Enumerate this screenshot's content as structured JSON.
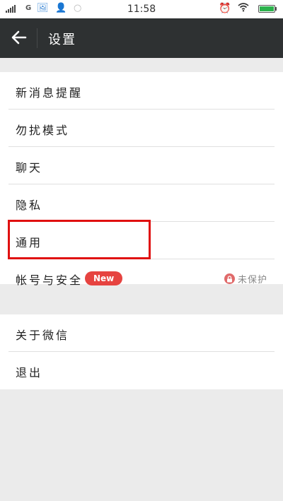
{
  "status_bar": {
    "network": "G",
    "time": "11:58"
  },
  "header": {
    "title": "设置"
  },
  "settings_group_1": [
    {
      "label": "新消息提醒"
    },
    {
      "label": "勿扰模式"
    },
    {
      "label": "聊天"
    },
    {
      "label": "隐私"
    },
    {
      "label": "通用"
    },
    {
      "label": "帐号与安全",
      "badge": "New",
      "status": "未保护"
    }
  ],
  "settings_group_2": [
    {
      "label": "关于微信"
    },
    {
      "label": "退出"
    }
  ],
  "colors": {
    "title_bar_bg": "#2e3132",
    "badge_bg": "#e64340",
    "highlight_border": "#e01010",
    "page_bg": "#ebebeb"
  }
}
